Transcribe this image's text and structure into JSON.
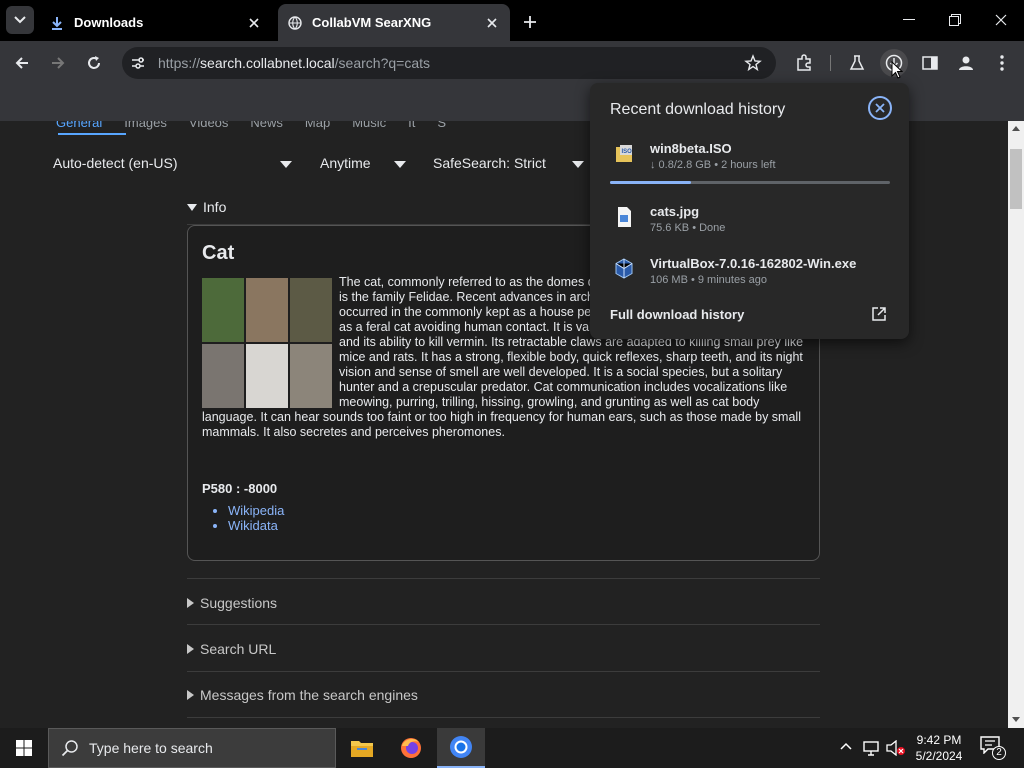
{
  "browser": {
    "tabs": [
      {
        "title": "Downloads",
        "icon": "download-icon"
      },
      {
        "title": "CollabVM SearXNG",
        "icon": "globe-icon"
      }
    ],
    "url_prefix": "https://",
    "url_host": "search.collabnet.local",
    "url_path": "/search?q=cats"
  },
  "page": {
    "categories": [
      "General",
      "Images",
      "Videos",
      "News",
      "Map",
      "Music",
      "It",
      "S"
    ],
    "active_category": "General",
    "filters": {
      "language": "Auto-detect (en-US)",
      "time": "Anytime",
      "safesearch": "SafeSearch: Strict"
    },
    "info_toggle": "Info",
    "infobox": {
      "title": "Cat",
      "text": "The cat, commonly referred to as the domes domesticated carnivorous mammal. It is the family Felidae. Recent advances in archaeo the domestication of the cat occurred in the commonly kept as a house pet and farm cat, but also ranges freely as a feral cat avoiding human contact. It is valued by humans for companionship and its ability to kill vermin. Its retractable claws are adapted to killing small prey like mice and rats. It has a strong, flexible body, quick reflexes, sharp teeth, and its night vision and sense of smell are well developed. It is a social species, but a solitary hunter and a crepuscular predator. Cat communication includes vocalizations like meowing, purring, trilling, hissing, growling, and grunting as well as cat body language. It can hear sounds too faint or too high in frequency for human ears, such as those made by small mammals. It also secretes and perceives pheromones.",
      "property": "P580 : -8000",
      "links": [
        "Wikipedia",
        "Wikidata"
      ]
    },
    "sections": [
      "Suggestions",
      "Search URL",
      "Messages from the search engines"
    ]
  },
  "downloads": {
    "header": "Recent download history",
    "items": [
      {
        "name": "win8beta.ISO",
        "meta": "↓ 0.8/2.8 GB • 2 hours left",
        "icon": "iso-file-icon",
        "progress": 0.29
      },
      {
        "name": "cats.jpg",
        "meta": "75.6 KB • Done",
        "icon": "image-file-icon"
      },
      {
        "name": "VirtualBox-7.0.16-162802-Win.exe",
        "meta": "106 MB • 9 minutes ago",
        "icon": "virtualbox-icon"
      }
    ],
    "full_history": "Full download history"
  },
  "taskbar": {
    "search_placeholder": "Type here to search",
    "time": "9:42 PM",
    "date": "5/2/2024",
    "notifications": "2"
  },
  "colors": {
    "accent": "#8ab4f8",
    "link": "#8ab4f8",
    "active_category": "#58a6ff"
  }
}
